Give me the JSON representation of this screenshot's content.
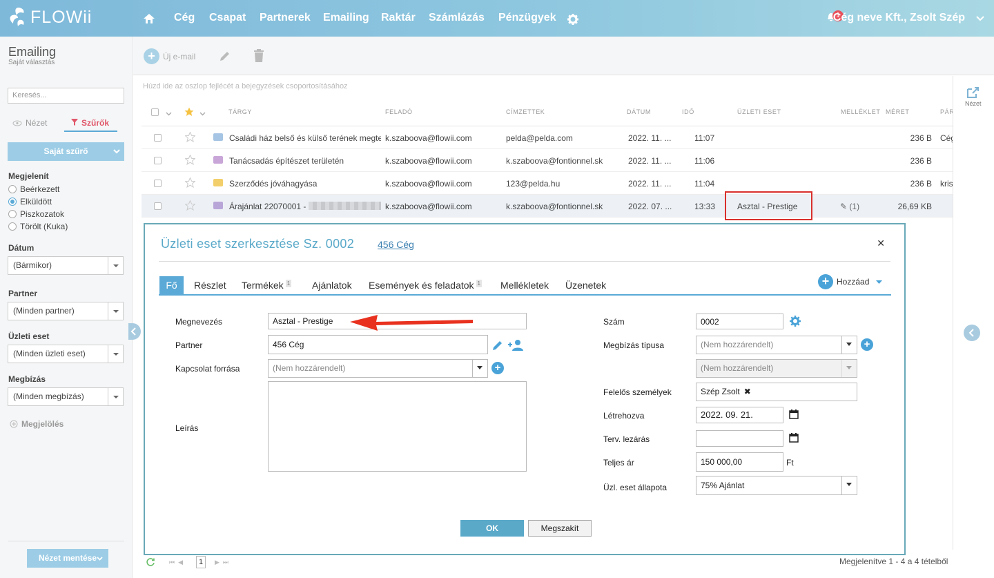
{
  "brand": {
    "name": "FLOWii"
  },
  "nav": {
    "items": [
      "Cég",
      "Csapat",
      "Partnerek",
      "Emailing",
      "Raktár",
      "Számlázás",
      "Pénzügyek"
    ],
    "notifications": "1",
    "company_user": "Cég neve Kft., Zsolt Szép"
  },
  "sidebar": {
    "title": "Emailing",
    "subtitle": "Saját választás",
    "search_placeholder": "Keresés...",
    "view_tab": "Nézet",
    "filter_tab": "Szűrők",
    "own_filter": "Saját szűrő",
    "show_label": "Megjelenít",
    "show_options": [
      "Beérkezett",
      "Elküldött",
      "Piszkozatok",
      "Törölt (Kuka)"
    ],
    "date_label": "Dátum",
    "date_value": "(Bármikor)",
    "partner_label": "Partner",
    "partner_value": "(Minden partner)",
    "deal_label": "Üzleti eset",
    "deal_value": "(Minden üzleti eset)",
    "order_label": "Megbízás",
    "order_value": "(Minden megbízás)",
    "mark_label": "Megjelölés",
    "save_view": "Nézet mentése"
  },
  "toolbar": {
    "new_email": "Új e-mail",
    "group_hint": "Húzd ide az oszlop fejlécét a bejegyzések csoportosításához",
    "view": "Nézet"
  },
  "table": {
    "headers": [
      "TÁRGY",
      "FELADÓ",
      "CÍMZETTEK",
      "DÁTUM",
      "IDŐ",
      "ÜZLETI ESET",
      "MELLÉKLET",
      "MÉRET",
      "PÁR"
    ],
    "rows": [
      {
        "subject": "Családi ház belső és külső terének megte",
        "sender": "k.szaboova@flowii.com",
        "recipients": "pelda@pelda.com",
        "date": "2022. 11. ...",
        "time": "11:07",
        "deal": "",
        "attachment": "",
        "size": "236 B",
        "extra": "Cég"
      },
      {
        "subject": "Tanácsadás építészet területén",
        "sender": "k.szaboova@flowii.com",
        "recipients": "k.szaboova@fontionnel.sk",
        "date": "2022. 11. ...",
        "time": "11:06",
        "deal": "",
        "attachment": "",
        "size": "236 B",
        "extra": ""
      },
      {
        "subject": "Szerződés jóváhagyása",
        "sender": "k.szaboova@flowii.com",
        "recipients": "123@pelda.hu",
        "date": "2022. 11. ...",
        "time": "11:04",
        "deal": "",
        "attachment": "",
        "size": "236 B",
        "extra": "kris"
      },
      {
        "subject": "Árajánlat 22070001 -",
        "sender": "k.szaboova@flowii.com",
        "recipients": "k.szaboova@fontionnel.sk",
        "date": "2022. 07. ...",
        "time": "13:33",
        "deal": "Asztal - Prestige",
        "attachment": "(1)",
        "size": "26,69 KB",
        "extra": ""
      }
    ]
  },
  "modal": {
    "title": "Üzleti eset szerkesztése Sz. 0002",
    "partner_link": "456 Cég",
    "tabs": [
      "Fő",
      "Részlet",
      "Termékek",
      "Ajánlatok",
      "Események és feladatok",
      "Mellékletek",
      "Üzenetek"
    ],
    "tab_counts": {
      "products": "1",
      "events": "1"
    },
    "add": "Hozzáad",
    "fields": {
      "name_label": "Megnevezés",
      "name_value": "Asztal - Prestige",
      "partner_label": "Partner",
      "partner_value": "456 Cég",
      "source_label": "Kapcsolat forrása",
      "source_value": "(Nem hozzárendelt)",
      "desc_label": "Leírás",
      "number_label": "Szám",
      "number_value": "0002",
      "order_type_label": "Megbízás típusa",
      "order_type_value": "(Nem hozzárendelt)",
      "order_type_sub": "(Nem hozzárendelt)",
      "responsible_label": "Felelős személyek",
      "responsible_value": "Szép Zsolt",
      "created_label": "Létrehozva",
      "created_value": "2022. 09. 21.",
      "planned_label": "Terv. lezárás",
      "planned_value": "",
      "price_label": "Teljes ár",
      "price_value": "150 000,00",
      "currency": "Ft",
      "status_label": "Üzl. eset állapota",
      "status_value": "75% Ajánlat"
    },
    "ok": "OK",
    "cancel": "Megszakít"
  },
  "footer": {
    "page": "1",
    "summary": "Megjelenítve 1 - 4 a 4 tételből"
  },
  "colors": {
    "accent": "#5aa9d6",
    "highlight": "#d9302c",
    "arrow": "#e8321f"
  }
}
